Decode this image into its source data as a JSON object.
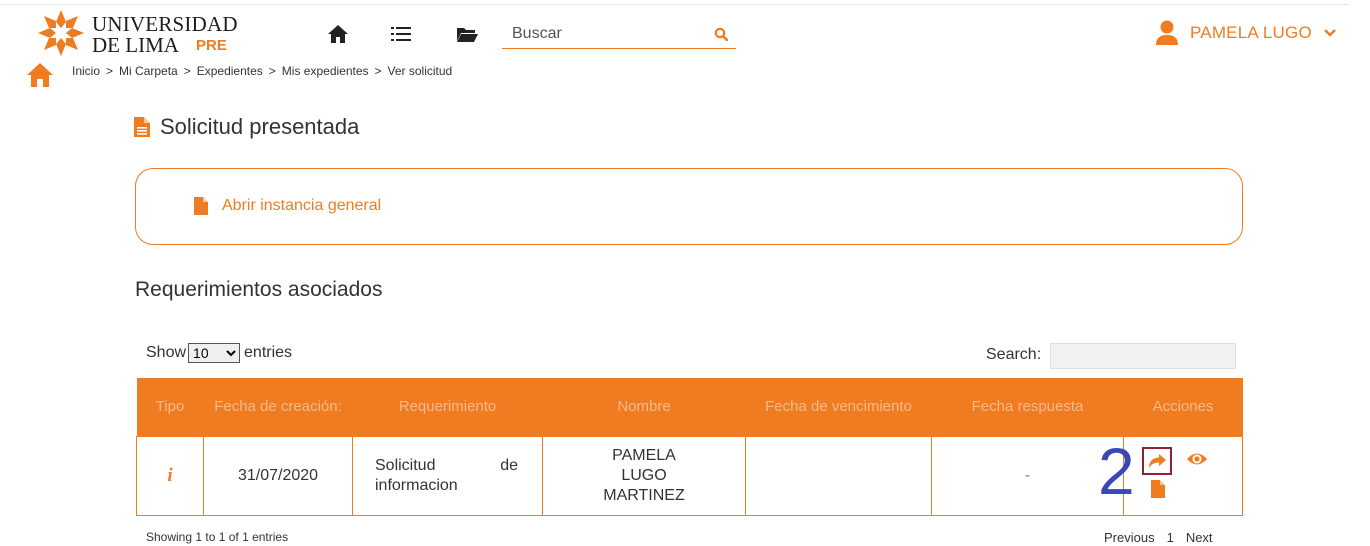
{
  "header": {
    "logo_line1": "UNIVERSIDAD",
    "logo_line2": "DE LIMA",
    "logo_badge": "PRE",
    "search_placeholder": "Buscar",
    "user_name": "PAMELA LUGO",
    "accent_color": "#f07c22"
  },
  "breadcrumb": {
    "items": [
      "Inicio",
      "Mi Carpeta",
      "Expedientes",
      "Mis expedientes",
      "Ver solicitud"
    ],
    "separator": ">"
  },
  "page": {
    "title": "Solicitud presentada",
    "instance_link": "Abrir instancia general",
    "section_title": "Requerimientos asociados"
  },
  "table_controls": {
    "show_label": "Show",
    "entries_label": "entries",
    "page_size": "10",
    "search_label": "Search:"
  },
  "table": {
    "columns": [
      "Tipo",
      "Fecha de creación:",
      "Requerimiento",
      "Nombre",
      "Fecha de vencimiento",
      "Fecha respuesta",
      "Acciones"
    ],
    "rows": [
      {
        "tipo_icon": "info-icon",
        "tipo": "i",
        "fecha_creacion": "31/07/2020",
        "requerimiento": "Solicitud de informacion",
        "nombre": "PAMELA LUGO MARTINEZ",
        "fecha_vencimiento": "",
        "fecha_respuesta": "-",
        "actions": [
          "share-icon",
          "eye-icon",
          "document-icon"
        ]
      }
    ]
  },
  "annotation": "2",
  "footer": {
    "showing": "Showing 1 to 1 of 1 entries",
    "previous": "Previous",
    "page": "1",
    "next": "Next"
  }
}
